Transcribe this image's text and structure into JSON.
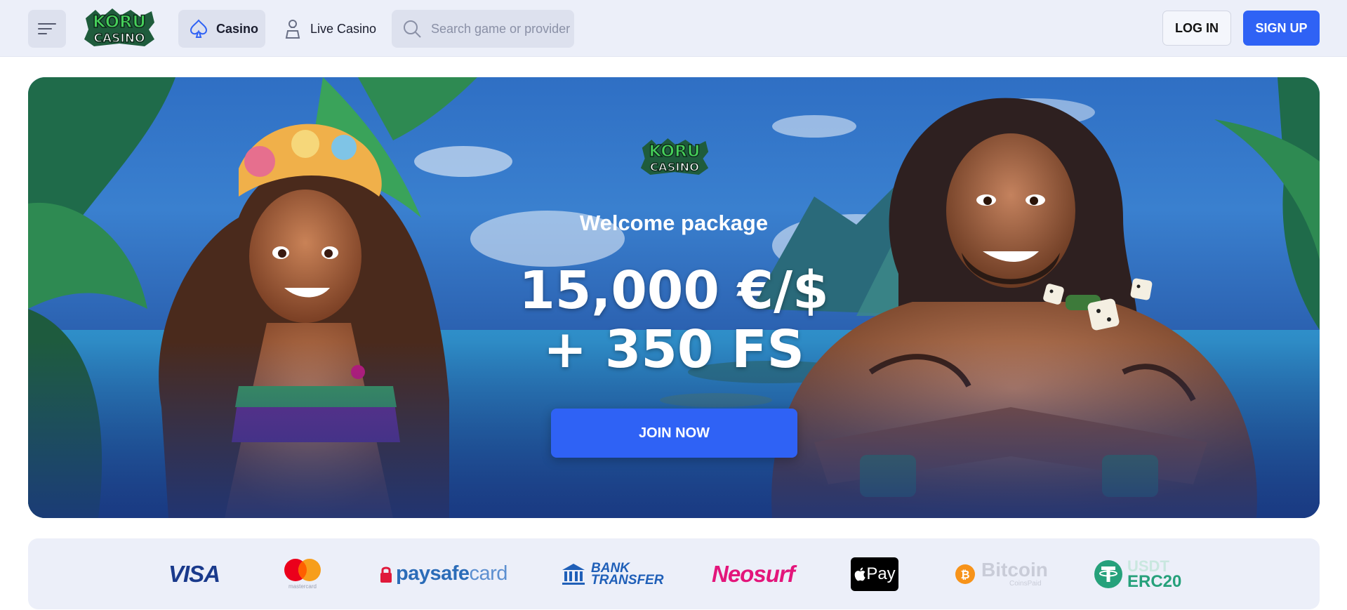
{
  "brand": {
    "logo_line1": "KORU",
    "logo_line2": "CASINO"
  },
  "header": {
    "nav": {
      "casino_label": "Casino",
      "live_label": "Live Casino"
    },
    "search": {
      "placeholder": "Search game or provider",
      "value": ""
    },
    "login_label": "LOG IN",
    "signup_label": "SIGN UP"
  },
  "hero": {
    "welcome": "Welcome package",
    "amount_line1": "15,000 €/$",
    "amount_line2": "+ 350 FS",
    "cta": "JOIN NOW"
  },
  "payments": {
    "visa": "VISA",
    "mastercard": "mastercard",
    "paysafecard_a": "paysafe",
    "paysafecard_b": "card",
    "bank_line1": "BANK",
    "bank_line2": "TRANSFER",
    "neosurf": "Neosurf",
    "applepay": "Pay",
    "bitcoin": "Bitcoin",
    "bitcoin_sub": "CoinsPaid",
    "usdt_line1": "USDT",
    "usdt_line2": "ERC20"
  },
  "colors": {
    "accent": "#2f62f5",
    "header_bg": "#eceff9",
    "button_bg": "#dde1ee"
  },
  "icons": [
    "menu-icon",
    "spade-icon",
    "dealer-icon",
    "search-icon",
    "apple-icon",
    "bitcoin-icon",
    "tether-icon",
    "bank-icon",
    "lock-icon"
  ]
}
